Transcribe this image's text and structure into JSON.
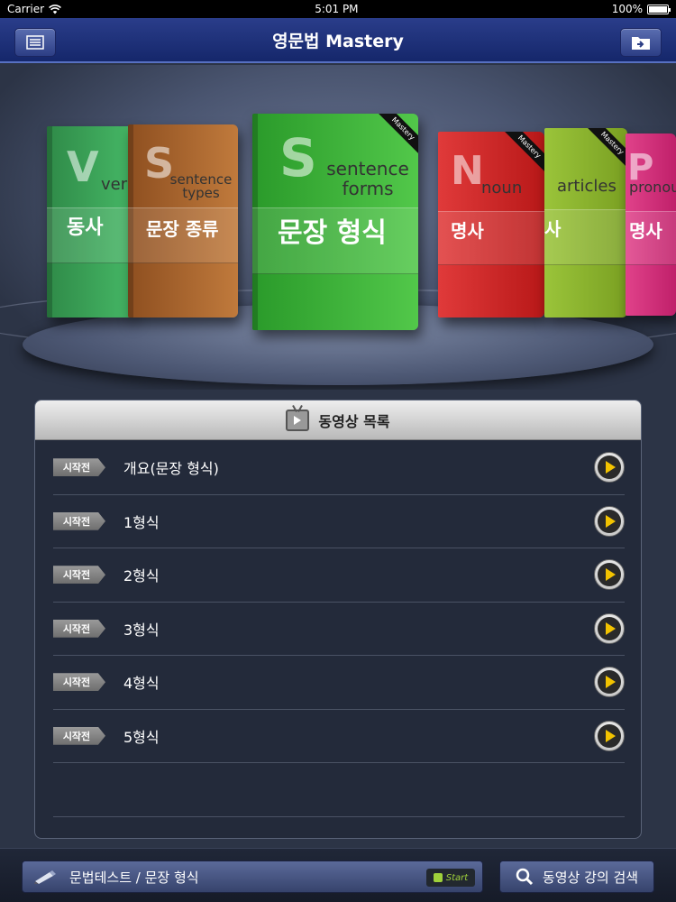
{
  "status": {
    "carrier": "Carrier",
    "time": "5:01 PM",
    "battery": "100%"
  },
  "nav": {
    "title": "영문법 Mastery"
  },
  "shelf": {
    "books": [
      {
        "letter": "V",
        "en": "verb",
        "ko": "동사",
        "color": "#3aa85a"
      },
      {
        "letter": "S",
        "en": "sentence types",
        "ko": "문장 종류",
        "color": "#b46a32"
      },
      {
        "letter": "S",
        "en": "sentence forms",
        "ko": "문장 형식",
        "color": "#3fb83a",
        "ribbon": "Mastery"
      },
      {
        "letter": "N",
        "en": "noun",
        "ko": "명사",
        "color": "#d42a2a",
        "ribbon": "Mastery"
      },
      {
        "letter": "",
        "en": "articles",
        "ko": "사",
        "color": "#8fb82a",
        "ribbon": "Mastery"
      },
      {
        "letter": "P",
        "en": "pronoun",
        "ko": "명사",
        "color": "#d42a7a"
      }
    ]
  },
  "panel": {
    "title": "동영상 목록",
    "items": [
      {
        "tag": "시작전",
        "label": "개요(문장 형식)"
      },
      {
        "tag": "시작전",
        "label": "1형식"
      },
      {
        "tag": "시작전",
        "label": "2형식"
      },
      {
        "tag": "시작전",
        "label": "3형식"
      },
      {
        "tag": "시작전",
        "label": "4형식"
      },
      {
        "tag": "시작전",
        "label": "5형식"
      }
    ]
  },
  "toolbar": {
    "test_label": "문법테스트 / 문장 형식",
    "start_label": "Start",
    "search_label": "동영상 강의 검색"
  }
}
